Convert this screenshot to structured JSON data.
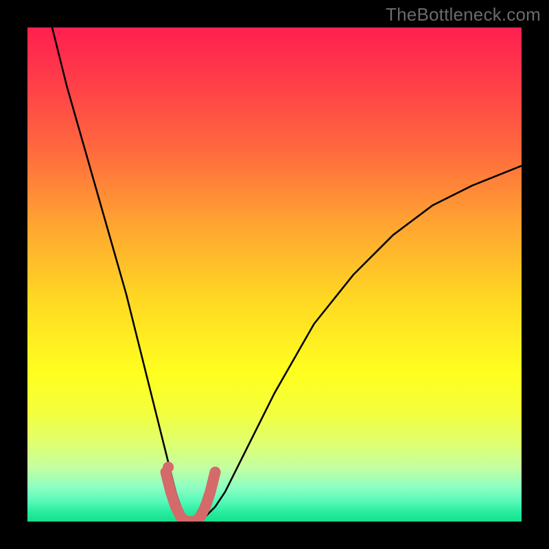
{
  "watermark": "TheBottleneck.com",
  "chart_data": {
    "type": "line",
    "title": "",
    "xlabel": "",
    "ylabel": "",
    "xlim": [
      0,
      100
    ],
    "ylim": [
      0,
      100
    ],
    "grid": false,
    "legend": false,
    "series": [
      {
        "name": "bottleneck-curve",
        "color": "#000000",
        "x": [
          5,
          8,
          12,
          16,
          20,
          24,
          26,
          28,
          30,
          31,
          32,
          33,
          34,
          35,
          36,
          38,
          40,
          44,
          50,
          58,
          66,
          74,
          82,
          90,
          100
        ],
        "values": [
          100,
          88,
          74,
          60,
          46,
          30,
          22,
          14,
          6,
          3,
          1,
          0,
          0,
          0,
          1,
          3,
          6,
          14,
          26,
          40,
          50,
          58,
          64,
          68,
          72
        ]
      }
    ],
    "highlight": {
      "name": "bottom-mask",
      "color": "#d46a6a",
      "x": [
        28,
        29,
        30,
        31,
        32,
        33,
        34,
        35,
        36,
        37,
        38
      ],
      "values": [
        10,
        6,
        3,
        1,
        0,
        0,
        0,
        1,
        3,
        6,
        10
      ]
    },
    "annotations": [
      {
        "type": "dot",
        "x": 28.5,
        "y": 11,
        "color": "#d46a6a"
      }
    ],
    "background": "vertical-gradient-red-to-green"
  }
}
